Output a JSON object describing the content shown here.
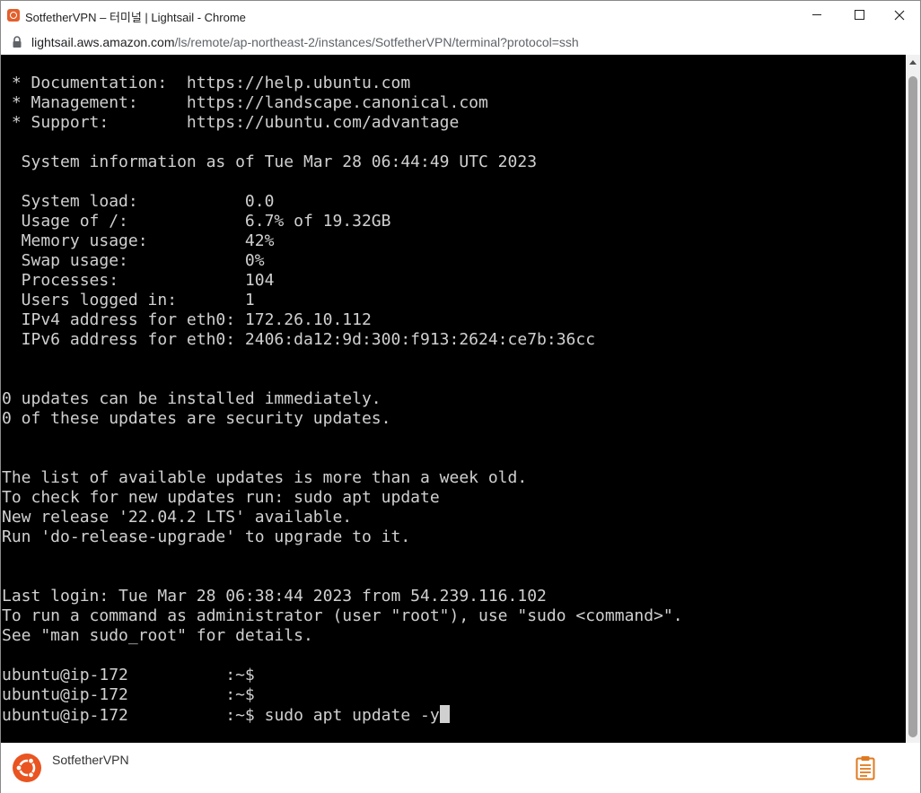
{
  "window": {
    "title": "SotfetherVPN – 터미널 | Lightsail - Chrome"
  },
  "address": {
    "host": "lightsail.aws.amazon.com",
    "path": "/ls/remote/ap-northeast-2/instances/SotfetherVPN/terminal?protocol=ssh"
  },
  "terminal": {
    "lines": [
      " * Documentation:  https://help.ubuntu.com",
      " * Management:     https://landscape.canonical.com",
      " * Support:        https://ubuntu.com/advantage",
      "",
      "  System information as of Tue Mar 28 06:44:49 UTC 2023",
      "",
      "  System load:           0.0",
      "  Usage of /:            6.7% of 19.32GB",
      "  Memory usage:          42%",
      "  Swap usage:            0%",
      "  Processes:             104",
      "  Users logged in:       1",
      "  IPv4 address for eth0: 172.26.10.112",
      "  IPv6 address for eth0: 2406:da12:9d:300:f913:2624:ce7b:36cc",
      "",
      "",
      "0 updates can be installed immediately.",
      "0 of these updates are security updates.",
      "",
      "",
      "The list of available updates is more than a week old.",
      "To check for new updates run: sudo apt update",
      "New release '22.04.2 LTS' available.",
      "Run 'do-release-upgrade' to upgrade to it.",
      "",
      "",
      "Last login: Tue Mar 28 06:38:44 2023 from 54.239.116.102",
      "To run a command as administrator (user \"root\"), use \"sudo <command>\".",
      "See \"man sudo_root\" for details.",
      "",
      "ubuntu@ip-172          :~$",
      "ubuntu@ip-172          :~$"
    ],
    "prompt": "ubuntu@ip-172          :~$ ",
    "current_command": "sudo apt update -y"
  },
  "footer": {
    "instance_name": "SotfetherVPN"
  },
  "icons": {
    "favicon": "lightsail-icon",
    "lock": "lock-icon",
    "ubuntu": "ubuntu-icon",
    "clipboard": "clipboard-icon"
  },
  "colors": {
    "ubuntu_orange": "#E95420",
    "clipboard_orange": "#E07A1F",
    "terminal_bg": "#000000",
    "terminal_fg": "#D0D0D0"
  }
}
